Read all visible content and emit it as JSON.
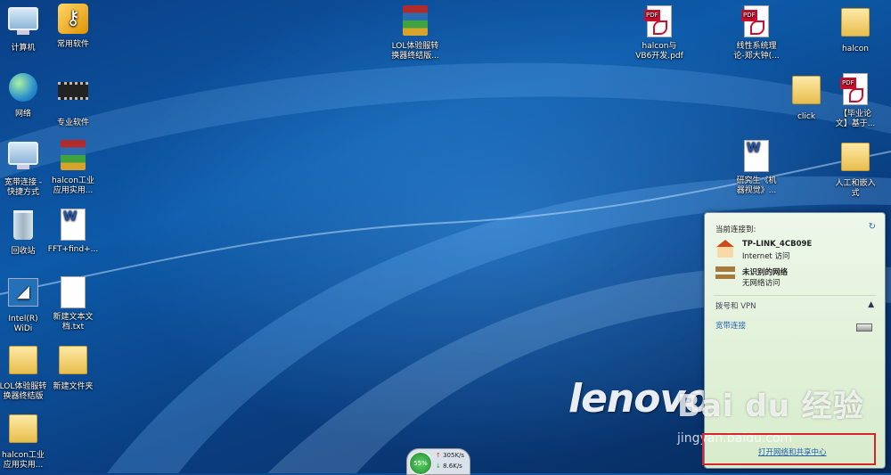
{
  "desktop": {
    "icons": [
      {
        "label": "计算机"
      },
      {
        "label": "常用软件"
      },
      {
        "label": "网络"
      },
      {
        "label": "专业软件"
      },
      {
        "label": "宽带连接 -\n快捷方式"
      },
      {
        "label": "halcon工业\n应用实用..."
      },
      {
        "label": "回收站"
      },
      {
        "label": "FFT+find+..."
      },
      {
        "label": "Intel(R)\nWiDi"
      },
      {
        "label": "新建文本文\n档.txt"
      },
      {
        "label": "LOL体验服转\n换器终结版"
      },
      {
        "label": "新建文件夹"
      },
      {
        "label": "halcon工业\n应用实用..."
      },
      {
        "label": "LOL体验服转\n换器终结版..."
      },
      {
        "label": "halcon与\nVB6开发.pdf"
      },
      {
        "label": "线性系统理\n论-郑大钟(..."
      },
      {
        "label": "halcon"
      },
      {
        "label": "click"
      },
      {
        "label": "【毕业论\n文】基于..."
      },
      {
        "label": "研究生《机\n器视觉》..."
      },
      {
        "label": "人工和嵌入\n式"
      }
    ],
    "logo_text": "lenovo"
  },
  "network_popup": {
    "header": "当前连接到:",
    "refresh_icon": "↻",
    "connections": [
      {
        "name": "TP-LINK_4CB09E",
        "status": "Internet 访问"
      },
      {
        "name": "未识别的网络",
        "status": "无网络访问"
      }
    ],
    "section_label": "拨号和 VPN",
    "section_chevron": "▲",
    "broadband_label": "宽带连接",
    "footer_link": "打开网络和共享中心"
  },
  "net_speed": {
    "percent": "55%",
    "upload": "305K/s",
    "download": "8.6K/s"
  },
  "watermark": {
    "main": "Bai du 经验",
    "sub": "jingyan.baidu.com"
  }
}
